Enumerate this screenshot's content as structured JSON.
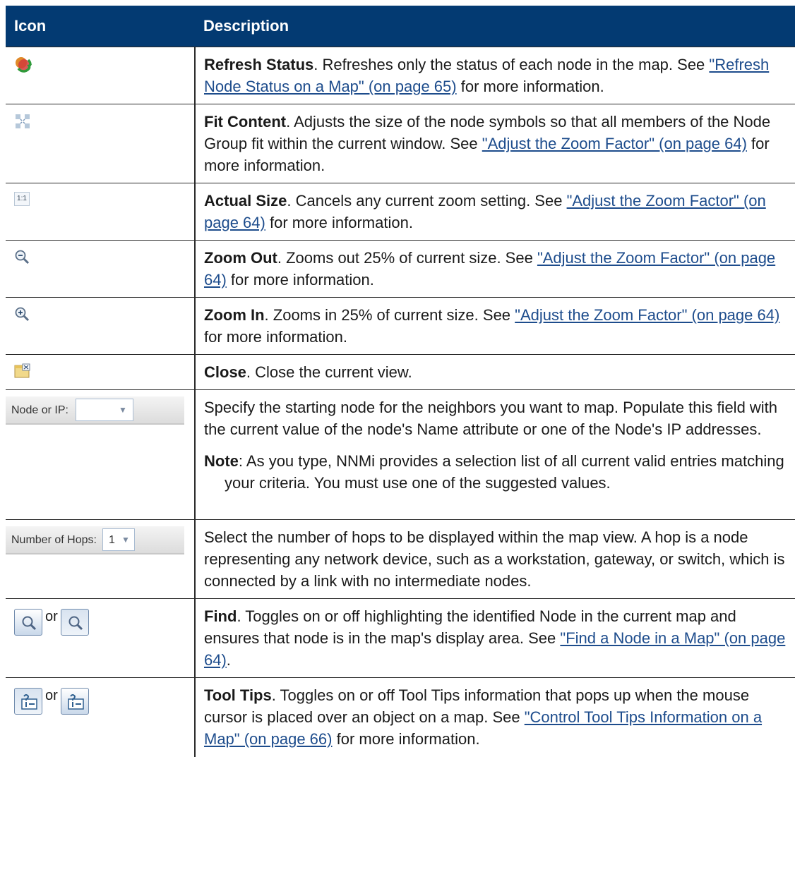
{
  "header": {
    "col_icon": "Icon",
    "col_description": "Description"
  },
  "rows": {
    "refresh": {
      "title": "Refresh Status",
      "text": ". Refreshes only the status of each node in the map. See ",
      "link": "\"Refresh Node Status on a Map\" (on page 65)",
      "after": " for more information."
    },
    "fit": {
      "title": "Fit Content",
      "text": ". Adjusts the size of the node symbols so that all members of the Node Group fit within the current window. See ",
      "link": "\"Adjust the Zoom Factor\" (on page 64)",
      "after": " for more information."
    },
    "actual": {
      "title": "Actual Size",
      "text": ". Cancels any current zoom setting. See ",
      "link": "\"Adjust the Zoom Factor\" (on page 64)",
      "after": " for more information.",
      "icon_text": "1:1"
    },
    "zoomout": {
      "title": "Zoom Out",
      "text": ". Zooms out 25% of current size. See ",
      "link": "\"Adjust the Zoom Factor\" (on page 64)",
      "after": " for more information."
    },
    "zoomin": {
      "title": "Zoom In",
      "text": ". Zooms in 25% of current size. See ",
      "link": "\"Adjust the Zoom Factor\" (on page 64)",
      "after": " for more information."
    },
    "close": {
      "title": "Close",
      "text": ". Close the current view."
    },
    "node": {
      "control_label": "Node or IP:",
      "control_value": "",
      "text": "Specify the starting node for the neighbors you want to map. Populate this field with the current value of the node's Name attribute or one of the Node's IP addresses.",
      "note_label": "Note",
      "note_text": ": As you type, NNMi provides a selection list of all current valid entries matching your criteria. You must use one of the suggested values."
    },
    "hops": {
      "control_label": "Number of Hops:",
      "control_value": "1",
      "text": "Select the number of hops to be displayed within the map view. A hop is a node representing any network device, such as a workstation, gateway, or switch, which is connected by a link with no intermediate nodes."
    },
    "find": {
      "or": "or",
      "title": "Find",
      "text": ". Toggles on or off highlighting the identified Node in the current map and ensures that node is in the map's display area. See ",
      "link": "\"Find a Node in a Map\" (on page 64)",
      "after": "."
    },
    "tooltips": {
      "or": "or",
      "title": "Tool Tips",
      "text": ". Toggles on or off Tool Tips information that pops up when the mouse cursor is placed over an object on a map. See ",
      "link": "\"Control Tool Tips Information on a Map\" (on page 66)",
      "after": " for more information."
    }
  },
  "colors": {
    "header_bg": "#033a72",
    "link": "#1d4c8c"
  }
}
